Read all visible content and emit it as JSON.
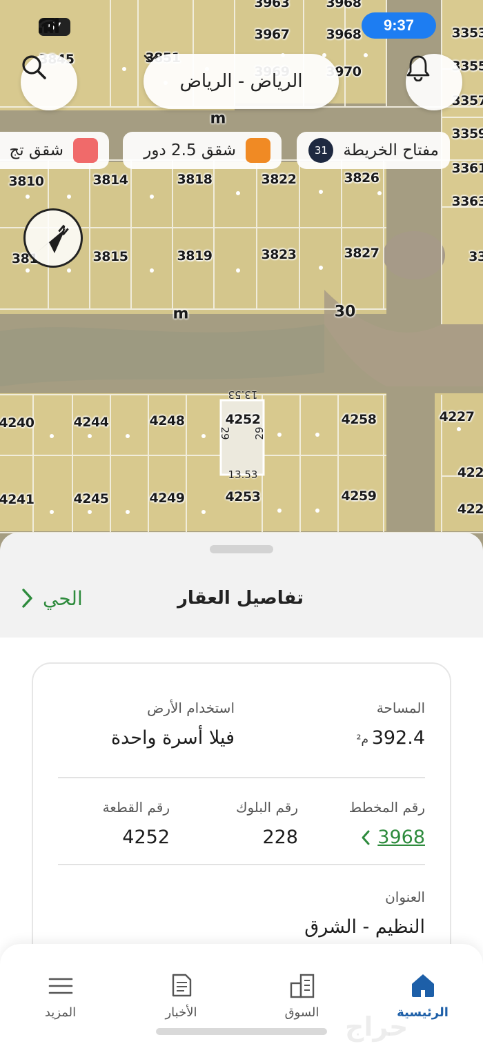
{
  "status_bar": {
    "time": "9:37",
    "battery": "57"
  },
  "map": {
    "city_selector": "الرياض - الرياض",
    "filters": [
      {
        "label": "مفتاح الخريطة",
        "badge": "31"
      },
      {
        "label": "شقق 2.5 دور",
        "color": "#f08a24"
      },
      {
        "label": "شقق تج",
        "color": "#f06a6a"
      }
    ],
    "road_labels": [
      "m",
      "m",
      "30"
    ],
    "top_numbers": [
      "3963",
      "3968",
      "3967",
      "3968",
      "3845",
      "3851",
      "3969",
      "3970"
    ],
    "right_edge_numbers": [
      "3353",
      "3355",
      "3357",
      "3359",
      "3361",
      "3363",
      "33",
      "4227",
      "422",
      "422"
    ],
    "row_a": [
      "3810",
      "3814",
      "3818",
      "3822",
      "3826"
    ],
    "row_b": [
      "381",
      "3815",
      "3819",
      "3823",
      "3827"
    ],
    "row_c": [
      "4240",
      "4244",
      "4248",
      "4252",
      "4258"
    ],
    "row_d": [
      "4241",
      "4245",
      "4249",
      "4253",
      "4259"
    ],
    "selected_dims": {
      "top": "13.53",
      "bottom": "13.53",
      "left": "29",
      "right": "29"
    }
  },
  "sheet": {
    "title": "تفاصيل العقار",
    "neighborhood_link": "الحي",
    "area_label": "المساحة",
    "area_value": "392.4",
    "area_unit": "م²",
    "land_use_label": "استخدام الأرض",
    "land_use_value": "فيلا أسرة واحدة",
    "plan_label": "رقم المخطط",
    "plan_value": "3968",
    "block_label": "رقم البلوك",
    "block_value": "228",
    "parcel_label": "رقم القطعة",
    "parcel_value": "4252",
    "address_label": "العنوان",
    "address_value": "النظيم - الشرق"
  },
  "tabs": [
    {
      "label": "الرئيسية",
      "icon": "home-icon",
      "active": true
    },
    {
      "label": "السوق",
      "icon": "buildings-icon",
      "active": false
    },
    {
      "label": "الأخبار",
      "icon": "news-icon",
      "active": false
    },
    {
      "label": "المزيد",
      "icon": "menu-icon",
      "active": false
    }
  ],
  "watermark": "حراج"
}
